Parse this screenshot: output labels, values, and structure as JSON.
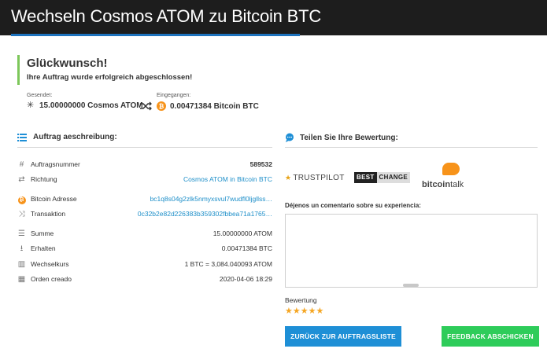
{
  "header": {
    "title": "Wechseln Cosmos ATOM zu Bitcoin BTC"
  },
  "success": {
    "heading": "Glückwunsch!",
    "message": "Ihre Auftrag wurde erfolgreich abgeschlossen!"
  },
  "exchange": {
    "sent_label": "Gesendet:",
    "sent_value": "15.00000000 Cosmos ATOM",
    "received_label": "Eingegangen:",
    "received_value": "0.00471384 Bitcoin BTC",
    "atom_glyph": "✳",
    "btc_glyph": "₿"
  },
  "order": {
    "title": "Auftrag aeschreibung:",
    "rows": [
      {
        "icon": "hash-icon",
        "glyph": "#",
        "label": "Auftragsnummer",
        "value": "589532"
      },
      {
        "icon": "direction-icon",
        "glyph": "⇄",
        "label": "Richtung",
        "value": "Cosmos ATOM in Bitcoin BTC"
      },
      {
        "icon": "bitcoin-icon",
        "glyph": "₿",
        "label": "Bitcoin Adresse",
        "value": "bc1q8s04g2zlk5nmyxsvul7wudfl0ljgllss…"
      },
      {
        "icon": "shuffle-icon",
        "glyph": "⤨",
        "label": "Transaktion",
        "value": "0c32b2e82d226383b359302fbbea71a1765…"
      },
      {
        "icon": "stack-icon",
        "glyph": "☰",
        "label": "Summe",
        "value": "15.00000000 ATOM"
      },
      {
        "icon": "download-icon",
        "glyph": "⭳",
        "label": "Erhalten",
        "value": "0.00471384 BTC"
      },
      {
        "icon": "chart-icon",
        "glyph": "▥",
        "label": "Wechselkurs",
        "value": "1 BTC = 3,084.040093 ATOM"
      },
      {
        "icon": "calendar-icon",
        "glyph": "▦",
        "label": "Orden creado",
        "value": "2020-04-06 18:29"
      }
    ]
  },
  "review": {
    "title": "Teilen Sie Ihre Bewertung:",
    "trustpilot": "TRUSTPILOT",
    "bestchange_a": "BEST",
    "bestchange_b": "CHANGE",
    "bitcointalk_a": "bitcoin",
    "bitcointalk_b": "talk",
    "comment_label": "Déjenos un comentario sobre su experiencia:",
    "comment_value": "",
    "rating_label": "Bewertung",
    "rating_stars": "★★★★★",
    "rating_value": 5
  },
  "buttons": {
    "back": "ZURÜCK ZUR AUFTRAGSLISTE",
    "feedback": "FEEDBACK ABSCHICKEN"
  },
  "colors": {
    "accent_blue": "#1e8fd6",
    "success_green": "#2ecc5a",
    "link_blue": "#1e8fc9",
    "bitcoin_orange": "#f7931a"
  }
}
